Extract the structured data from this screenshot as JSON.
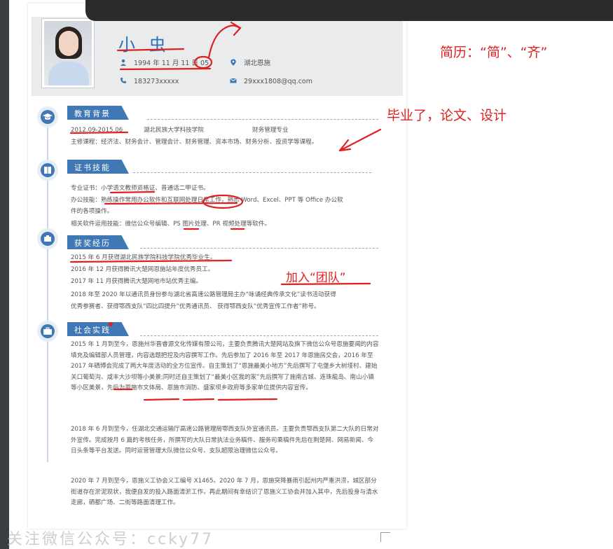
{
  "header": {
    "name": "小 虫",
    "birth": "1994 年 11 月 11 日 05",
    "location": "湖北恩施",
    "phone": "183273xxxxx",
    "email": "29xxx1808@qq.com"
  },
  "sections": {
    "education": {
      "title": "教育背景",
      "period": "2012.09-2015.06",
      "school": "湖北民族大学科技学院",
      "major": "财务管理专业",
      "courses": "主修课程：经济法、财务会计、管理会计、财务管理、资本市场、财务分析、投资学等课程。"
    },
    "certs": {
      "title": "证书技能",
      "line1": "专业证书：小学语文教师资格证、普通话二甲证书。",
      "line2": "办公技能：熟练操作常用办公软件和互联网处理日常工作，熟悉 Word、Excel、PPT 等 Office 办公软",
      "line3": "件的各项操作。",
      "line4": "相关软件运用技能：微信公众号编辑、PS 图片处理、PR 视频处理等软件。"
    },
    "awards": {
      "title": "获奖经历",
      "line1": "2015 年 6 月获得湖北民族学院科技学院优秀毕业生。",
      "line2": "2016 年 12 月获得腾讯大楚网恩施站年度优秀员工。",
      "line3": "2017 年 11 月获得腾讯大楚网地市站优秀主编。",
      "line4": "2018 年至 2020 年以通讯员身份参与湖北省高速公路管理局主办“咏诵经典传承文化”读书活动获得",
      "line5": "优秀参赛者、获得鄂西支队“四比四提升”优秀通讯员、 获得鄂西支队“优秀宣传工作者”称号。"
    },
    "practice": {
      "title": "社会实践",
      "para1": "2015 年 1 月到至今，恩施州华晋睿源文化传媒有限公司，主要负责腾讯大楚网站及旗下微信公众号恩施要闻的内容填充及编辑部人员管理，内容选题把控及内容撰写工作。先后参加了 2016 年至 2017 年恩施房交会，2016 年至 2017 年硒博会完成了两大年度活动的全方位宣传。自主策划了“恩施最美小地方”先后撰写了屯堡乡大树垭村、建始关口葡萄沟、咸丰大沙坝等小美景;同时还自主策划了“最美小区我的家”先后撰写了施南古城、连珠龍岛、南山小镇等小区美景，先后为恩施市文体局、恩施市消防、盛家坝乡政府等多家单位提供内容宣传。",
      "para2": "2018 年 6 月到至今，任湖北交通运输厅高速公路管理局鄂西支队外宣通讯员。主要负责鄂西支队第二大队的日常对外宣传。完成按月 6 篇的考核任务，所撰写的大队日常执法业务稿件、服务司乘稿件先后在荆楚网、网易新闻、今日头条等平台发送。同时运营管理大队微信公众号、支队超限治理微信公众号。",
      "para3": "2020 年 7 月到至今，恩施义工协会义工编号 X1465。2020 年 7 月，恩施突降暴雨引起州内严重洪涝，城区部分街道存在淤泥现状，我便自发的投入路面清淤工作，再此期间有幸结识了恩施义工协会并加入其中，先后投身与清水走廊，硒都广场、二街等路面清理工作。"
    }
  },
  "annotations": {
    "top_note": "简历：“简”、“齐”",
    "grad_note": "毕业了，论文、设计",
    "team_note": "加入“团队”"
  },
  "watermark": "关注微信公众号：ccky77",
  "colors": {
    "accent": "#3f78b4",
    "annotation_red": "#e02020",
    "header_bg": "#e9ebed"
  }
}
